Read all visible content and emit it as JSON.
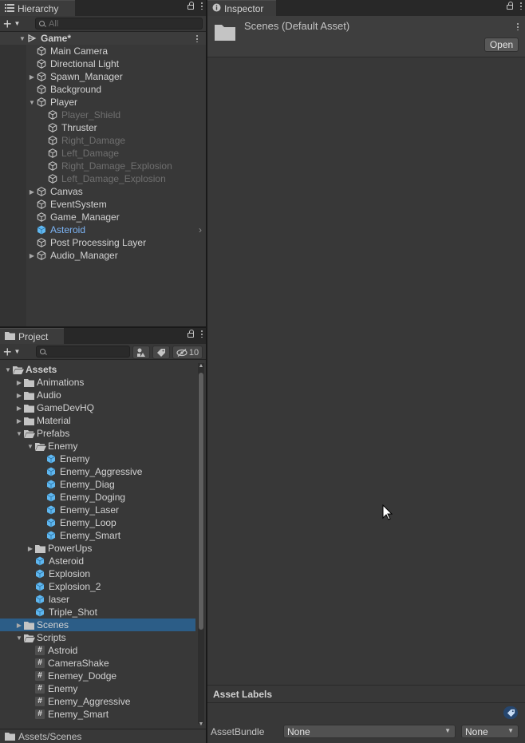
{
  "hierarchy": {
    "tab_label": "Hierarchy",
    "search_placeholder": "All",
    "items": [
      {
        "label": "Game*",
        "kind": "scene",
        "arrow": "expanded",
        "bold": true
      },
      {
        "label": "Main Camera",
        "kind": "gameobject"
      },
      {
        "label": "Directional Light",
        "kind": "gameobject"
      },
      {
        "label": "Spawn_Manager",
        "kind": "gameobject",
        "arrow": "collapsed"
      },
      {
        "label": "Background",
        "kind": "gameobject"
      },
      {
        "label": "Player",
        "kind": "gameobject",
        "arrow": "expanded"
      },
      {
        "label": "Player_Shield",
        "kind": "gameobject",
        "state": "inactive"
      },
      {
        "label": "Thruster",
        "kind": "gameobject"
      },
      {
        "label": "Right_Damage",
        "kind": "gameobject",
        "state": "inactive"
      },
      {
        "label": "Left_Damage",
        "kind": "gameobject",
        "state": "inactive"
      },
      {
        "label": "Right_Damage_Explosion",
        "kind": "gameobject",
        "state": "inactive"
      },
      {
        "label": "Left_Damage_Explosion",
        "kind": "gameobject",
        "state": "inactive"
      },
      {
        "label": "Canvas",
        "kind": "gameobject",
        "arrow": "collapsed"
      },
      {
        "label": "EventSystem",
        "kind": "gameobject"
      },
      {
        "label": "Game_Manager",
        "kind": "gameobject"
      },
      {
        "label": "Asteroid",
        "kind": "prefab",
        "has_submenu": true
      },
      {
        "label": "Post Processing Layer",
        "kind": "gameobject"
      },
      {
        "label": "Audio_Manager",
        "kind": "gameobject",
        "arrow": "collapsed"
      }
    ]
  },
  "inspector": {
    "tab_label": "Inspector",
    "asset_title": "Scenes (Default Asset)",
    "open_button": "Open",
    "asset_labels_header": "Asset Labels",
    "assetbundle_label": "AssetBundle",
    "assetbundle_value": "None",
    "variant_value": "None"
  },
  "project": {
    "tab_label": "Project",
    "search_placeholder": "",
    "hidden_count": "10",
    "status_path": "Assets/Scenes",
    "items": [
      {
        "label": "Assets",
        "kind": "folder-open",
        "arrow": "expanded",
        "bold": true
      },
      {
        "label": "Animations",
        "kind": "folder",
        "arrow": "collapsed"
      },
      {
        "label": "Audio",
        "kind": "folder",
        "arrow": "collapsed"
      },
      {
        "label": "GameDevHQ",
        "kind": "folder",
        "arrow": "collapsed"
      },
      {
        "label": "Material",
        "kind": "folder",
        "arrow": "collapsed"
      },
      {
        "label": "Prefabs",
        "kind": "folder-open",
        "arrow": "expanded"
      },
      {
        "label": "Enemy",
        "kind": "folder-open",
        "arrow": "expanded"
      },
      {
        "label": "Enemy",
        "kind": "prefab"
      },
      {
        "label": "Enemy_Aggressive",
        "kind": "prefab"
      },
      {
        "label": "Enemy_Diag",
        "kind": "prefab"
      },
      {
        "label": "Enemy_Doging",
        "kind": "prefab"
      },
      {
        "label": "Enemy_Laser",
        "kind": "prefab"
      },
      {
        "label": "Enemy_Loop",
        "kind": "prefab"
      },
      {
        "label": "Enemy_Smart",
        "kind": "prefab"
      },
      {
        "label": "PowerUps",
        "kind": "folder",
        "arrow": "collapsed"
      },
      {
        "label": "Asteroid",
        "kind": "prefab"
      },
      {
        "label": "Explosion",
        "kind": "prefab"
      },
      {
        "label": "Explosion_2",
        "kind": "prefab"
      },
      {
        "label": "laser",
        "kind": "prefab"
      },
      {
        "label": "Triple_Shot",
        "kind": "prefab"
      },
      {
        "label": "Scenes",
        "kind": "folder",
        "arrow": "collapsed",
        "selected": true
      },
      {
        "label": "Scripts",
        "kind": "folder-open",
        "arrow": "expanded"
      },
      {
        "label": "Astroid",
        "kind": "script"
      },
      {
        "label": "CameraShake",
        "kind": "script"
      },
      {
        "label": "Enemey_Dodge",
        "kind": "script"
      },
      {
        "label": "Enemy",
        "kind": "script"
      },
      {
        "label": "Enemy_Aggressive",
        "kind": "script"
      },
      {
        "label": "Enemy_Smart",
        "kind": "script"
      }
    ]
  },
  "colors": {
    "selection": "#2c5d87",
    "prefab_blue": "#5fb7f0",
    "inactive_text": "#6f6f6f"
  }
}
